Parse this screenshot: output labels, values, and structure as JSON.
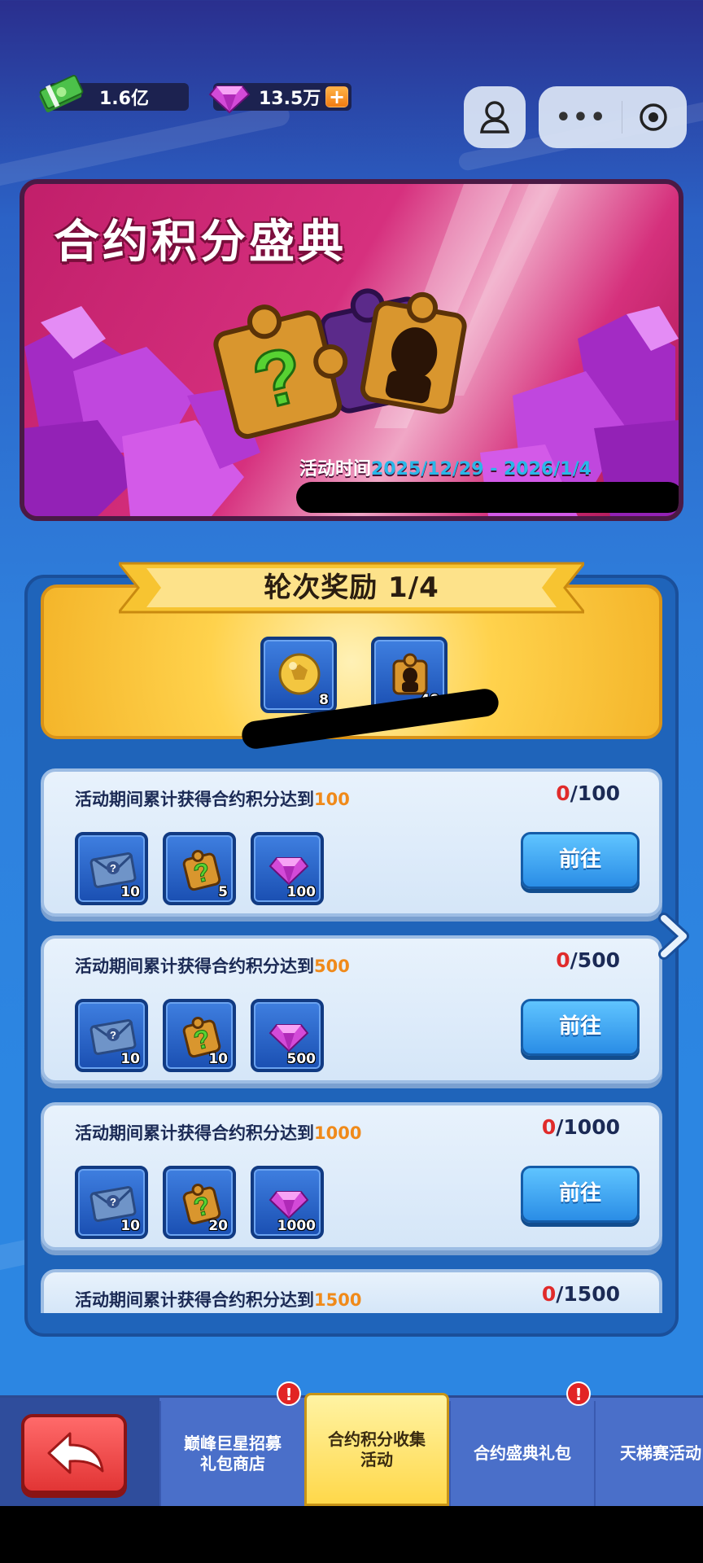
{
  "currency": {
    "cash": "1.6亿",
    "gems": "13.5万",
    "plus": "+"
  },
  "top_controls": {
    "more": "•••"
  },
  "banner": {
    "title": "合约积分盛典",
    "time_label": "活动时间",
    "time_range": "2025/12/29 - 2026/1/4"
  },
  "round_reward": {
    "title": "轮次奖励 1/4",
    "items": [
      {
        "icon": "gold-ball-icon",
        "count": "8"
      },
      {
        "icon": "silhouette-puzzle-icon",
        "count": "40"
      }
    ]
  },
  "tasks": [
    {
      "desc_prefix": "活动期间累计获得合约积分达到",
      "target": "100",
      "progress_current": "0",
      "progress_total": "/100",
      "button": "前往",
      "rewards": [
        {
          "icon": "envelope-icon",
          "count": "10"
        },
        {
          "icon": "question-puzzle-icon",
          "count": "5"
        },
        {
          "icon": "gem-icon",
          "count": "100"
        }
      ]
    },
    {
      "desc_prefix": "活动期间累计获得合约积分达到",
      "target": "500",
      "progress_current": "0",
      "progress_total": "/500",
      "button": "前往",
      "rewards": [
        {
          "icon": "envelope-icon",
          "count": "10"
        },
        {
          "icon": "question-puzzle-icon",
          "count": "10"
        },
        {
          "icon": "gem-icon",
          "count": "500"
        }
      ]
    },
    {
      "desc_prefix": "活动期间累计获得合约积分达到",
      "target": "1000",
      "progress_current": "0",
      "progress_total": "/1000",
      "button": "前往",
      "rewards": [
        {
          "icon": "envelope-icon",
          "count": "10"
        },
        {
          "icon": "question-puzzle-icon",
          "count": "20"
        },
        {
          "icon": "gem-icon",
          "count": "1000"
        }
      ]
    },
    {
      "desc_prefix": "活动期间累计获得合约积分达到",
      "target": "1500",
      "progress_current": "0",
      "progress_total": "/1500"
    }
  ],
  "bottom_nav": {
    "tabs": [
      {
        "line1": "巅峰巨星招募",
        "line2": "礼包商店",
        "badge": "!"
      },
      {
        "line1": "合约积分收集",
        "line2": "活动",
        "active": true
      },
      {
        "line1": "合约盛典礼包",
        "line2": "",
        "badge": "!"
      },
      {
        "line1": "天梯赛活动",
        "line2": ""
      }
    ]
  },
  "colors": {
    "accent_orange": "#f08a1a",
    "progress_red": "#e02b2b",
    "date_blue": "#29b7e8"
  }
}
